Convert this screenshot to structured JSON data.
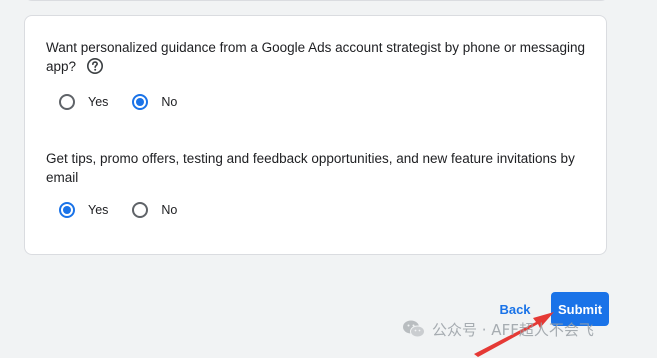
{
  "question1": {
    "text": "Want personalized guidance from a Google Ads account strategist by phone or messaging app?",
    "options": [
      {
        "label": "Yes",
        "checked": false
      },
      {
        "label": "No",
        "checked": true
      }
    ],
    "help_icon": "help-circle-icon"
  },
  "question2": {
    "text": "Get tips, promo offers, testing and feedback opportunities, and new feature invitations by email",
    "options": [
      {
        "label": "Yes",
        "checked": true
      },
      {
        "label": "No",
        "checked": false
      }
    ]
  },
  "footer": {
    "back_label": "Back",
    "submit_label": "Submit"
  },
  "watermark": {
    "text": "公众号 · AFF超人不会飞",
    "icon": "wechat-icon"
  },
  "colors": {
    "accent": "#1a73e8",
    "background": "#f1f3f4",
    "card": "#ffffff",
    "arrow": "#e53935"
  }
}
